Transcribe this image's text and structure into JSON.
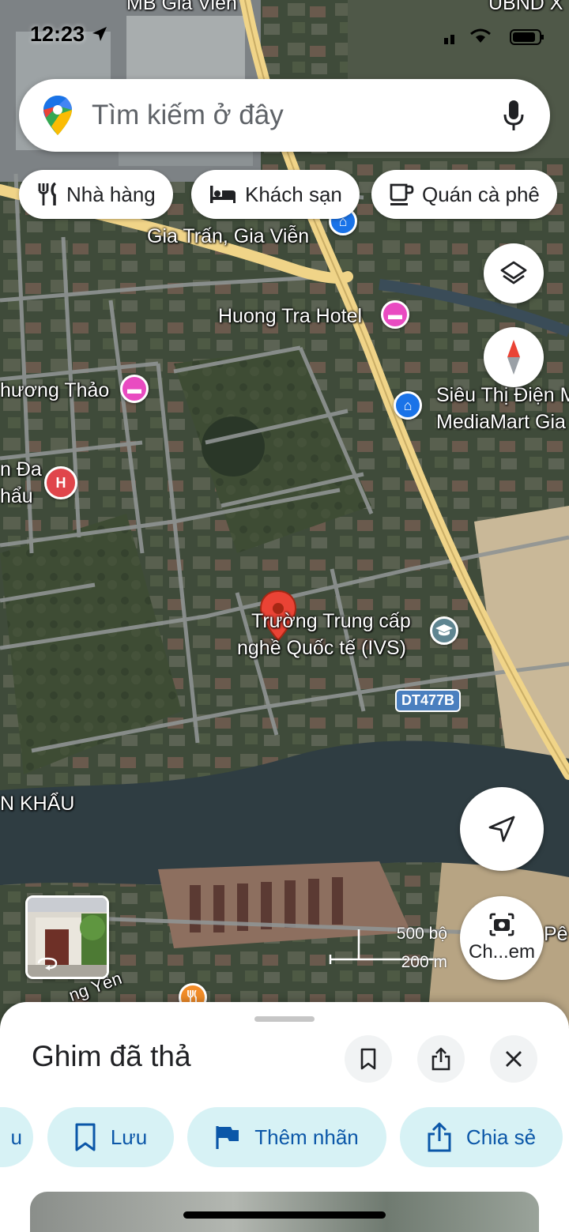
{
  "status_bar": {
    "time": "12:23"
  },
  "search": {
    "placeholder": "Tìm kiếm ở đây"
  },
  "chips": [
    {
      "label": "Nhà hàng",
      "icon": "restaurant-icon"
    },
    {
      "label": "Khách sạn",
      "icon": "hotel-icon"
    },
    {
      "label": "Quán cà phê",
      "icon": "coffee-icon"
    }
  ],
  "map": {
    "labels": {
      "top_clip": "MB Gia Viễn",
      "top_right_clip": "UBND X",
      "store_line1": "Siêu Thị Điện M",
      "store_line2": "MediaMart Gia",
      "gia_tran": "Gia Trấn, Gia Viễn",
      "huong_tra": "Huong Tra Hotel",
      "phuong_thao": "hương Thảo",
      "hospital_line1": "n Đa",
      "hospital_line2": "hẩu",
      "school_line1": "Trường Trung cấp",
      "school_line2": "nghề Quốc tế (IVS)",
      "road_badge": "DT477B",
      "khau": "N KHẨU",
      "hung_yen": "ng Yên",
      "pe": "Pê"
    },
    "scale": {
      "imperial": "500 bộ",
      "metric": "200 m"
    },
    "layers_icon": "layers-icon",
    "compass_icon": "compass-icon",
    "location_icon": "navigation-arrow-icon",
    "lens_label": "Ch...em"
  },
  "sheet": {
    "title": "Ghim đã thả",
    "actions": [
      {
        "label": "u",
        "icon": "partial-chip"
      },
      {
        "label": "Lưu",
        "icon": "bookmark-icon"
      },
      {
        "label": "Thêm nhãn",
        "icon": "flag-icon"
      },
      {
        "label": "Chia sẻ",
        "icon": "share-icon"
      }
    ]
  },
  "colors": {
    "accent": "#0b57a8",
    "chip_bg": "#d7f2f5",
    "pin_red": "#ea4335",
    "hotel_pink": "#e94bc1",
    "store_blue": "#1a73e8",
    "road_yellow": "#f5d98a"
  }
}
